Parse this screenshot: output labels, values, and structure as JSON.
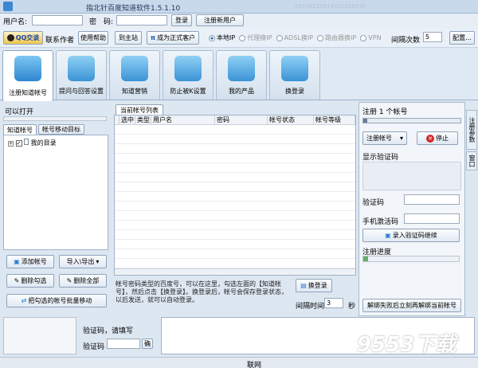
{
  "title": "指北针百度知道软件1.5.1.10",
  "watermark_url": "20178155614331028330",
  "login": {
    "username_label": "用户名:",
    "password_label": "密　码:",
    "login_btn": "登录",
    "register_btn": "注册新用户"
  },
  "bar2": {
    "qq_btn": "QQ交谈",
    "contact": "联系作者",
    "help_btn": "使用帮助",
    "site_btn": "到主站",
    "upgrade_btn": "成为正式客户",
    "ip_modes": [
      "本地IP",
      "代理换IP",
      "ADSL换IP",
      "路由器换IP",
      "VPN"
    ],
    "interval_label": "间隔次数",
    "interval_value": "5",
    "config_btn": "配置..."
  },
  "tabs": [
    {
      "label": "注册知道帐号"
    },
    {
      "label": "提问与回答设置"
    },
    {
      "label": "知道营销"
    },
    {
      "label": "防止被K设置"
    },
    {
      "label": "我的产品"
    },
    {
      "label": "换登录"
    }
  ],
  "left": {
    "ready": "可以打开",
    "subtabs": [
      "知道帐号",
      "帐号移动目标"
    ],
    "tree_root": "我的目录",
    "add_btn": "添加帐号",
    "import_btn": "导入\\导出",
    "del_checked_btn": "删除勾选",
    "del_all_btn": "删除全部",
    "move_btn": "把勾选的帐号批量移动"
  },
  "center": {
    "tab": "当前帐号列表",
    "columns": [
      "选中",
      "类型",
      "用户名",
      "密码",
      "帐号状态",
      "帐号等级"
    ],
    "note": "帐号密码类型的百度号，可以在这里，勾选左面的【知道帐号】，然后点击【换登录】。换登录后，帐号会保存登录状态，以后发送，就可以自动登录。",
    "swap_btn": "换登录",
    "interval_label": "间隔时间",
    "interval_value": "3",
    "sec": "秒"
  },
  "right": {
    "reg_label": "注册 1 个帐号",
    "account_dd": "注册帐号",
    "stop_btn": "停止",
    "captcha_label": "显示验证码",
    "captcha_field": "验证码",
    "sms_field": "手机激活码",
    "enter_btn": "录入验证码继续",
    "progress_label": "注册进度",
    "progress": 0.05,
    "unbind_btn": "解绑失败后立刻再解绑当前帐号",
    "side_tabs": [
      "注册参数",
      "窗口"
    ]
  },
  "bottom": {
    "status_text": "验证码，请填写",
    "captcha_label": "验证码",
    "ok_btn": "确"
  },
  "status": {
    "net": "联网"
  },
  "brand": {
    "logo": "9553下载"
  }
}
